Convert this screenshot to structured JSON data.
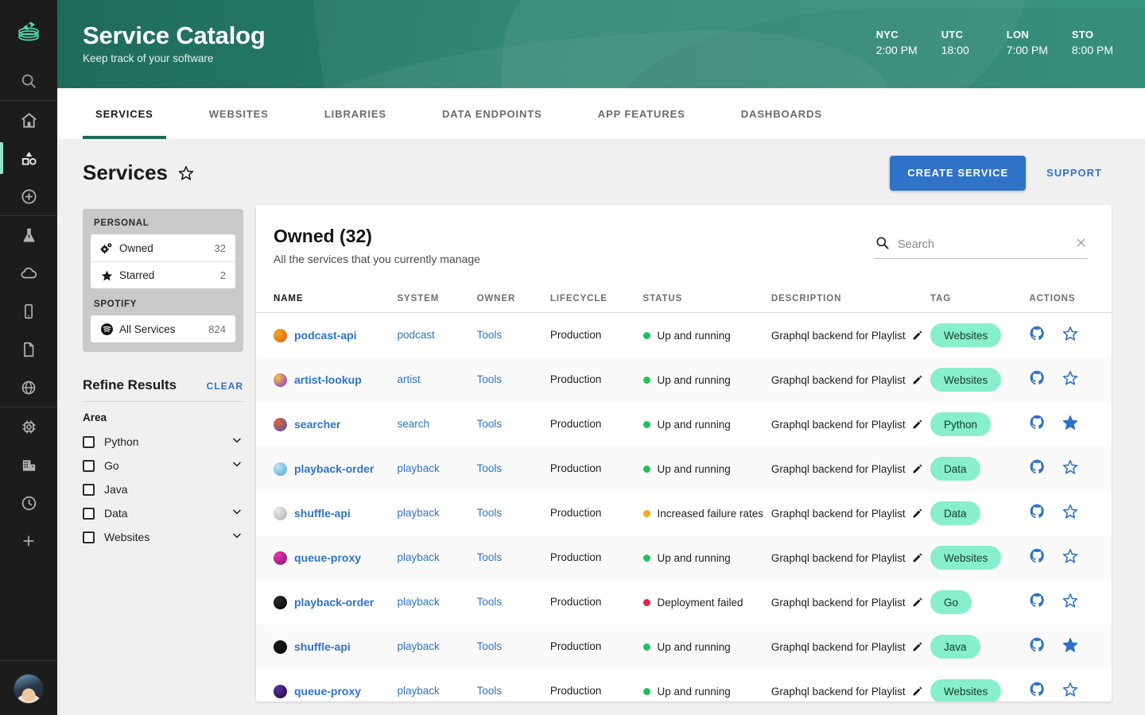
{
  "rail": {
    "logo_icon": "stacked-coins-logo",
    "items": [
      {
        "name": "search-icon"
      },
      {
        "name": "home-icon"
      },
      {
        "name": "shapes-catalog-icon",
        "active": true
      },
      {
        "name": "plus-circle-icon"
      },
      {
        "name": "flask-icon"
      },
      {
        "name": "cloud-icon"
      },
      {
        "name": "mobile-icon"
      },
      {
        "name": "document-icon"
      },
      {
        "name": "globe-icon"
      },
      {
        "name": "chip-icon"
      },
      {
        "name": "building-icon"
      },
      {
        "name": "clock-icon"
      },
      {
        "name": "plus-icon"
      }
    ],
    "avatar": "user-avatar"
  },
  "header": {
    "title": "Service Catalog",
    "subtitle": "Keep track of your software",
    "clocks": [
      {
        "city": "NYC",
        "time": "2:00 PM"
      },
      {
        "city": "UTC",
        "time": "18:00"
      },
      {
        "city": "LON",
        "time": "7:00 PM"
      },
      {
        "city": "STO",
        "time": "8:00 PM"
      }
    ]
  },
  "tabs": [
    {
      "label": "SERVICES",
      "active": true
    },
    {
      "label": "WEBSITES",
      "active": false
    },
    {
      "label": "LIBRARIES",
      "active": false
    },
    {
      "label": "DATA ENDPOINTS",
      "active": false
    },
    {
      "label": "APP FEATURES",
      "active": false
    },
    {
      "label": "DASHBOARDS",
      "active": false
    }
  ],
  "page": {
    "title": "Services",
    "star_icon": "star-outline-icon",
    "create_label": "CREATE SERVICE",
    "support_label": "SUPPORT"
  },
  "filters": {
    "personal_label": "PERSONAL",
    "personal_items": [
      {
        "label": "Owned",
        "count": "32",
        "icon": "gears-icon"
      },
      {
        "label": "Starred",
        "count": "2",
        "icon": "star-filled-icon"
      }
    ],
    "spotify_label": "SPOTIFY",
    "spotify_items": [
      {
        "label": "All Services",
        "count": "824",
        "icon": "spotify-icon"
      }
    ],
    "refine_title": "Refine Results",
    "clear_label": "CLEAR",
    "facet_title": "Area",
    "facets": [
      {
        "label": "Python",
        "checked": false,
        "expandable": true
      },
      {
        "label": "Go",
        "checked": false,
        "expandable": true
      },
      {
        "label": "Java",
        "checked": false,
        "expandable": false
      },
      {
        "label": "Data",
        "checked": false,
        "expandable": true
      },
      {
        "label": "Websites",
        "checked": false,
        "expandable": true
      }
    ]
  },
  "panel": {
    "title": "Owned (32)",
    "subtitle": "All the services that you currently manage",
    "search_placeholder": "Search",
    "search_value": "",
    "columns": [
      "NAME",
      "SYSTEM",
      "OWNER",
      "LIFECYCLE",
      "STATUS",
      "DESCRIPTION",
      "TAG",
      "ACTIONS"
    ],
    "colors": {
      "accent_blue": "#2f73c8",
      "brand_green": "#1f6b5b",
      "tag_green": "#87efc9",
      "status_ok": "#21c05c",
      "status_warn": "#f5a623",
      "status_error": "#e0274b"
    },
    "rows": [
      {
        "name": "podcast-api",
        "icon_colors": [
          "#f0a818",
          "#e05a20"
        ],
        "system": "podcast",
        "owner": "Tools",
        "lifecycle": "Production",
        "status": "Up and running",
        "status_color": "#21c05c",
        "description": "Graphql backend for Playlist",
        "tag": "Websites",
        "starred": false
      },
      {
        "name": "artist-lookup",
        "icon_colors": [
          "#f5c542",
          "#8a2be2"
        ],
        "system": "artist",
        "owner": "Tools",
        "lifecycle": "Production",
        "status": "Up and running",
        "status_color": "#21c05c",
        "description": "Graphql backend for Playlist",
        "tag": "Websites",
        "starred": false
      },
      {
        "name": "searcher",
        "icon_colors": [
          "#e8602c",
          "#3b5bb5"
        ],
        "system": "search",
        "owner": "Tools",
        "lifecycle": "Production",
        "status": "Up and running",
        "status_color": "#21c05c",
        "description": "Graphql backend for Playlist",
        "tag": "Python",
        "starred": true
      },
      {
        "name": "playback-order",
        "icon_colors": [
          "#bfe3f5",
          "#4aa8d8"
        ],
        "system": "playback",
        "owner": "Tools",
        "lifecycle": "Production",
        "status": "Up and running",
        "status_color": "#21c05c",
        "description": "Graphql backend for Playlist",
        "tag": "Data",
        "starred": false
      },
      {
        "name": "shuffle-api",
        "icon_colors": [
          "#e8e8e8",
          "#b0b0b0"
        ],
        "system": "playback",
        "owner": "Tools",
        "lifecycle": "Production",
        "status": "Increased failure rates",
        "status_color": "#f5a623",
        "description": "Graphql backend for Playlist",
        "tag": "Data",
        "starred": false
      },
      {
        "name": "queue-proxy",
        "icon_colors": [
          "#e830b0",
          "#7a1a6a"
        ],
        "system": "playback",
        "owner": "Tools",
        "lifecycle": "Production",
        "status": "Up and running",
        "status_color": "#21c05c",
        "description": "Graphql backend for Playlist",
        "tag": "Websites",
        "starred": false
      },
      {
        "name": "playback-order",
        "icon_colors": [
          "#2a2a2a",
          "#000000"
        ],
        "system": "playback",
        "owner": "Tools",
        "lifecycle": "Production",
        "status": "Deployment failed",
        "status_color": "#e0274b",
        "description": "Graphql backend for Playlist",
        "tag": "Go",
        "starred": false
      },
      {
        "name": "shuffle-api",
        "icon_colors": [
          "#1a1a1a",
          "#000000"
        ],
        "system": "playback",
        "owner": "Tools",
        "lifecycle": "Production",
        "status": "Up and running",
        "status_color": "#21c05c",
        "description": "Graphql backend for Playlist",
        "tag": "Java",
        "starred": true
      },
      {
        "name": "queue-proxy",
        "icon_colors": [
          "#5a2fa0",
          "#1a0a38"
        ],
        "system": "playback",
        "owner": "Tools",
        "lifecycle": "Production",
        "status": "Up and running",
        "status_color": "#21c05c",
        "description": "Graphql backend for Playlist",
        "tag": "Websites",
        "starred": false
      }
    ]
  }
}
